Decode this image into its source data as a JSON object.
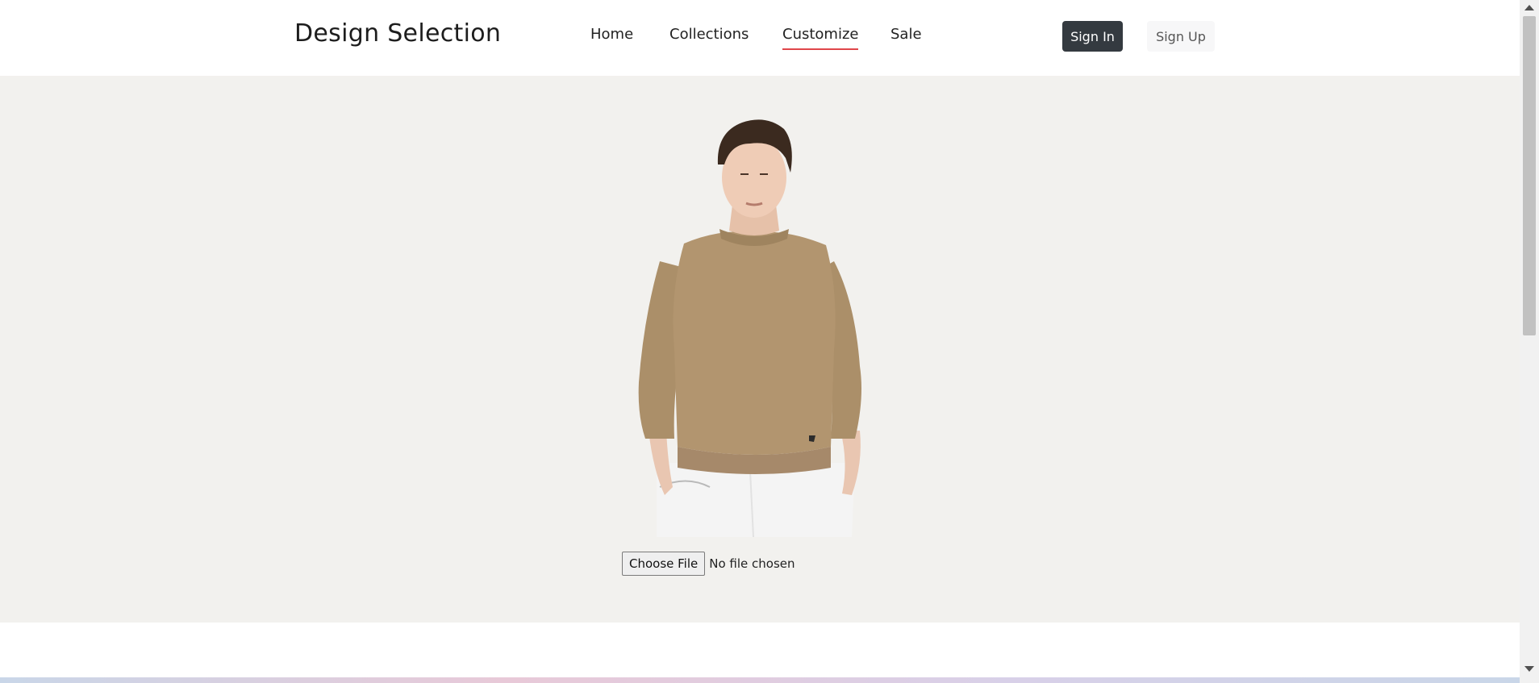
{
  "brand": "Design Selection",
  "nav": {
    "items": [
      {
        "label": "Home"
      },
      {
        "label": "Collections"
      },
      {
        "label": "Customize",
        "active": true
      },
      {
        "label": "Sale"
      }
    ]
  },
  "auth": {
    "sign_in": "Sign In",
    "sign_up": "Sign Up"
  },
  "product": {
    "image_icon": "model-in-beige-sweatshirt-image"
  },
  "upload": {
    "button_label": "Choose File",
    "status": "No file chosen"
  },
  "colors": {
    "accent_underline": "#e0464a",
    "signin_bg": "#343a40",
    "hero_bg": "#f2f1ee",
    "sweater": "#b2956f"
  }
}
